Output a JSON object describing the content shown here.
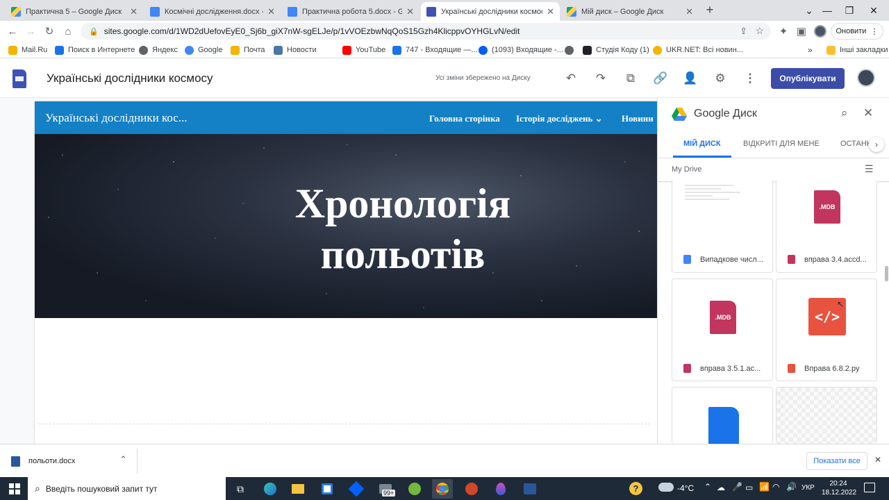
{
  "browser": {
    "tabs": [
      {
        "title": "Практична 5 – Google Диск",
        "icon": "drive-icon"
      },
      {
        "title": "Космічні дослідження.docx - Go",
        "icon": "docs-icon"
      },
      {
        "title": "Практична робота 5.docx - Goo",
        "icon": "docs-icon"
      },
      {
        "title": "Українські дослідники космосу",
        "icon": "sites-icon",
        "active": true
      },
      {
        "title": "Мій диск – Google Диск",
        "icon": "drive-icon"
      }
    ],
    "url": "sites.google.com/d/1WD2dUefovEyE0_Sj6b_giX7nW-sgELJe/p/1vVOEzbwNqQoS15Gzh4KlicppvOYHGLvN/edit",
    "update_label": "Оновити",
    "bookmarks": [
      "Mail.Ru",
      "Поиск в Интернете",
      "Яндекс",
      "Google",
      "Почта",
      "Новости",
      "YouTube",
      "747 - Входящие —...",
      "(1093) Входящие -...",
      "Студія Коду (1)",
      "UKR.NET: Всі новин..."
    ],
    "bookmarks_more": "»",
    "other_bookmarks": "Інші закладки"
  },
  "sites": {
    "doc_title": "Українські дослідники космосу",
    "save_status": "Усі зміни збережено на Диску",
    "publish_label": "Опублікувати"
  },
  "site": {
    "nav_title": "Українські дослідники кос...",
    "nav_items": [
      "Головна сторінка",
      "Історія досліджень",
      "Новини"
    ],
    "hero_title_line1": "Хронологія",
    "hero_title_line2": "польотів"
  },
  "drive_panel": {
    "title": "Google Диск",
    "tabs": [
      "МІЙ ДИСК",
      "ВІДКРИТІ ДЛЯ МЕНЕ",
      "ОСТАНН"
    ],
    "active_tab": "МІЙ ДИСК",
    "breadcrumb": "My Drive",
    "files": [
      {
        "name": "Випадкове числ...",
        "type": "doc"
      },
      {
        "name": "вправа 3.4.accd...",
        "type": "mdb",
        "badge": ".MDB"
      },
      {
        "name": "вправа 3.5.1.ac...",
        "type": "mdb",
        "badge": ".MDB"
      },
      {
        "name": "Вправа 6.8.2.py",
        "type": "code"
      },
      {
        "name": "",
        "type": "file-blue"
      },
      {
        "name": "",
        "type": "blank"
      }
    ]
  },
  "download_shelf": {
    "file_name": "польоти.docx",
    "show_all_label": "Показати все"
  },
  "taskbar": {
    "search_placeholder": "Введіть пошуковий запит тут",
    "weather": "-4°C",
    "language": "УКР",
    "time": "20:24",
    "date": "18.12.2022",
    "badge_count": "99+"
  },
  "colors": {
    "site_nav": "#1480c5",
    "publish": "#3b4da8",
    "drive_accent": "#1a73e8",
    "mdb": "#c2355e",
    "code": "#e8533f"
  }
}
